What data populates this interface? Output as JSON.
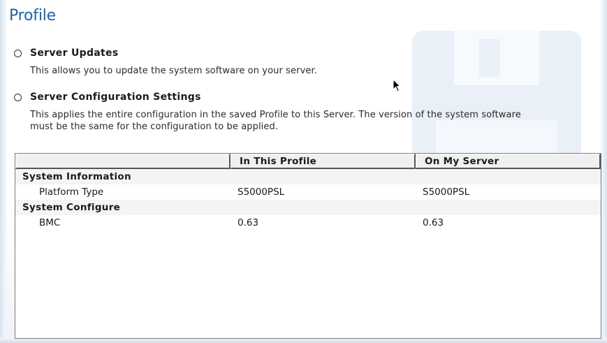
{
  "page": {
    "title": "Profile"
  },
  "options": [
    {
      "label": "Server Updates",
      "description": "This allows you to update the system software on your server."
    },
    {
      "label": "Server Configuration Settings",
      "description_line1": "This applies the entire configuration in the saved Profile to this Server. The version of the system software",
      "description_line2": "must be the same for the configuration to be applied."
    }
  ],
  "table": {
    "headers": [
      "",
      "In This Profile",
      "On My Server"
    ],
    "sections": [
      {
        "name": "System Information",
        "rows": [
          {
            "label": "Platform Type",
            "profile": "S5000PSL",
            "server": "S5000PSL"
          }
        ]
      },
      {
        "name": "System Configure",
        "rows": [
          {
            "label": "BMC",
            "profile": "0.63",
            "server": "0.63"
          }
        ]
      }
    ]
  },
  "colors": {
    "title": "#1f63a5",
    "watermark": "#e9f0f7"
  },
  "icons": [
    "radio-button-icon",
    "floppy-disk-icon",
    "mouse-pointer-icon"
  ]
}
